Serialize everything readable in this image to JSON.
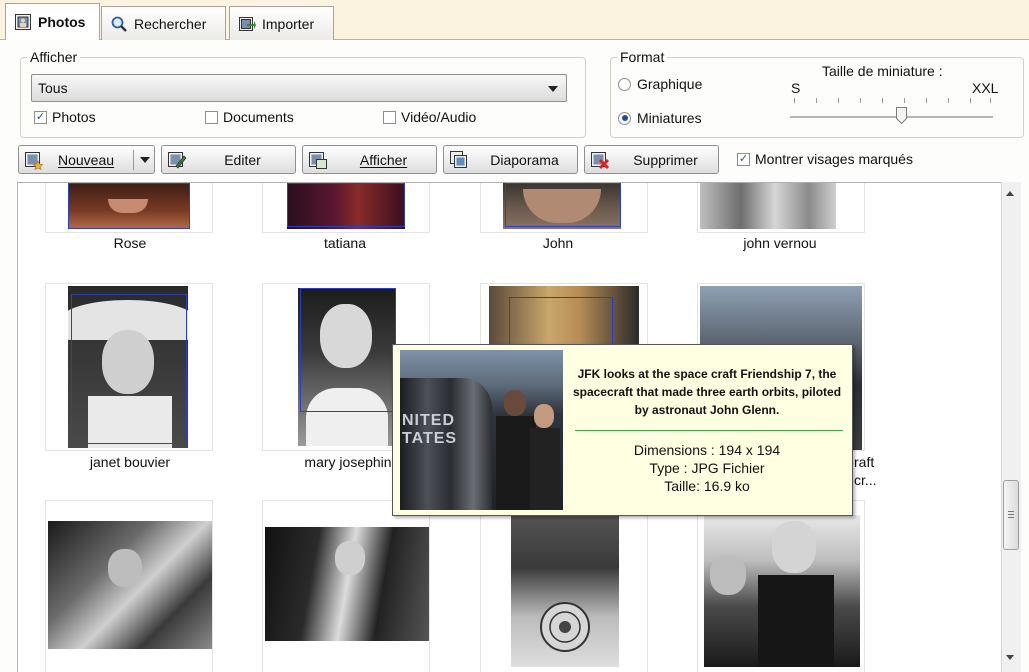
{
  "tabs": [
    {
      "label": "Photos",
      "icon": "photo-frame-icon",
      "active": true
    },
    {
      "label": "Rechercher",
      "icon": "magnifier-icon"
    },
    {
      "label": "Importer",
      "icon": "import-icon"
    }
  ],
  "display": {
    "legend": "Afficher",
    "filter_value": "Tous",
    "photos_label": "Photos",
    "photos_checked": true,
    "documents_label": "Documents",
    "documents_checked": false,
    "media_label": "Vidéo/Audio",
    "media_checked": false
  },
  "format": {
    "legend": "Format",
    "graphic_label": "Graphique",
    "thumbnails_label": "Miniatures",
    "selected": "Miniatures",
    "slider_title": "Taille de miniature :",
    "slider_min": "S",
    "slider_max": "XXL",
    "slider_level": 0.55
  },
  "toolbar": {
    "new_label": "Nouveau",
    "edit_label": "Editer",
    "show_label": "Afficher",
    "slideshow_label": "Diaporama",
    "delete_label": "Supprimer",
    "show_faces_label": "Montrer visages marqués",
    "show_faces_checked": true
  },
  "thumbnails": {
    "row1": [
      "Rose",
      "tatiana",
      "John",
      "john vernou"
    ],
    "row2": [
      "janet bouvier",
      "mary josephin",
      "raft",
      "cr..."
    ]
  },
  "tooltip": {
    "caption": "JFK looks at the space craft Friendship 7, the spacecraft that made three earth orbits, piloted by astronaut John Glenn.",
    "dimensions": "Dimensions : 194 x 194",
    "type": "Type : JPG Fichier",
    "size": "Taille: 16.9 ko"
  },
  "colors": {
    "accent_blue": "#2b3fbf",
    "tooltip_bg": "#ffffe1",
    "divider_green": "#3aa845"
  }
}
